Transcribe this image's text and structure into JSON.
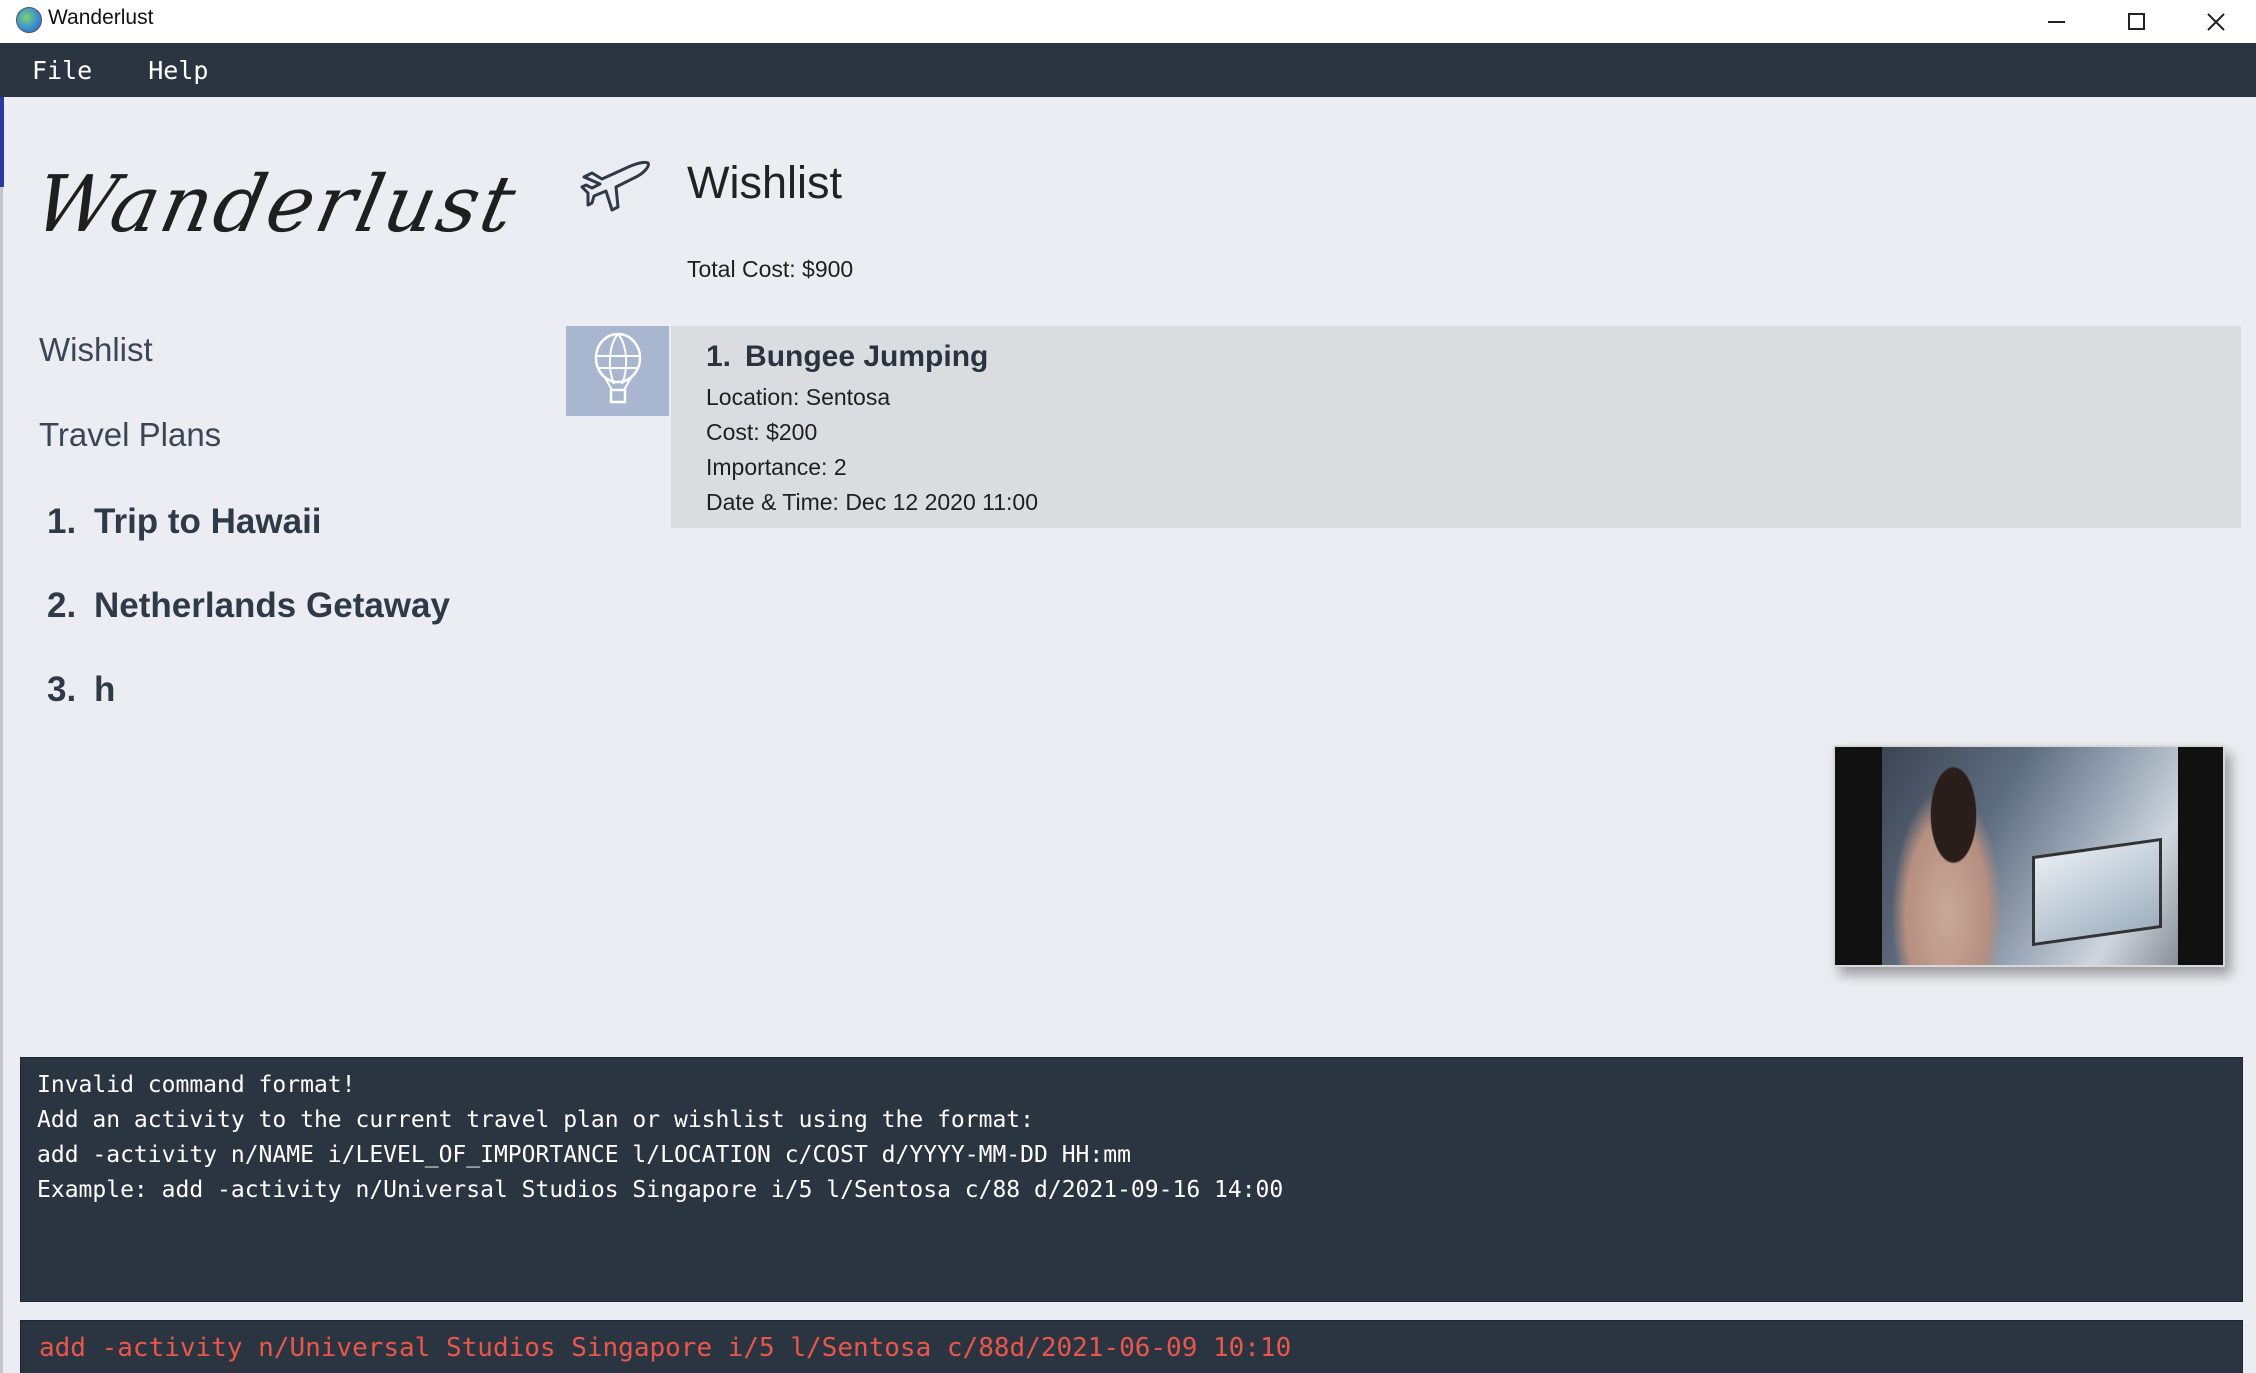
{
  "window": {
    "title": "Wanderlust",
    "controls": {
      "minimize": "minimize-icon",
      "maximize": "maximize-icon",
      "close": "close-icon"
    }
  },
  "menu": {
    "items": [
      {
        "label": "File"
      },
      {
        "label": "Help"
      }
    ]
  },
  "sidebar": {
    "logo": "Wanderlust",
    "nav": {
      "wishlist": "Wishlist",
      "travel_plans": "Travel Plans"
    },
    "plans": [
      {
        "index": "1.",
        "name": "Trip to Hawaii"
      },
      {
        "index": "2.",
        "name": "Netherlands Getaway"
      },
      {
        "index": "3.",
        "name": "h"
      }
    ]
  },
  "main": {
    "icon": "airplane-icon",
    "title": "Wishlist",
    "total_cost": "Total Cost: $900",
    "activities": [
      {
        "icon": "hot-air-balloon-icon",
        "index": "1.",
        "name": "Bungee Jumping",
        "location": "Location: Sentosa",
        "cost": "Cost: $200",
        "importance": "Importance: 2",
        "datetime": "Date & Time: Dec 12 2020 11:00"
      }
    ]
  },
  "result": {
    "lines": [
      "Invalid command format!",
      "Add an activity to the current travel plan or wishlist using the format:",
      "add -activity n/NAME i/LEVEL_OF_IMPORTANCE l/LOCATION c/COST d/YYYY-MM-DD HH:mm",
      "Example: add -activity n/Universal Studios Singapore i/5 l/Sentosa c/88 d/2021-09-16 14:00"
    ]
  },
  "command": {
    "value": "add -activity n/Universal Studios Singapore i/5 l/Sentosa c/88d/2021-06-09 10:10"
  },
  "colors": {
    "menubar_bg": "#2b3542",
    "page_bg": "#ecedf2",
    "card_bg": "#dbdcdf",
    "icon_box_bg": "#a8b6cf",
    "command_text": "#e8574a"
  }
}
